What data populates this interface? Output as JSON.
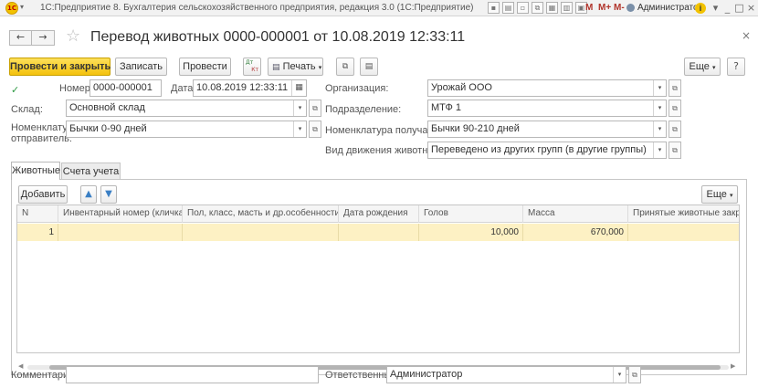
{
  "app": {
    "title": "1С:Предприятие 8. Бухгалтерия сельскохозяйственного предприятия, редакция 3.0  (1С:Предприятие)",
    "logo_text": "1С",
    "user": "Администратор",
    "m_labels": [
      "M",
      "M+",
      "M-"
    ]
  },
  "document": {
    "title": "Перевод животных 0000-000001 от 10.08.2019 12:33:11"
  },
  "toolbar": {
    "post_close": "Провести и закрыть",
    "save": "Записать",
    "post": "Провести",
    "dtkt_top": "Дт",
    "dtkt_bottom": "Кт",
    "print": "Печать",
    "more": "Еще"
  },
  "form": {
    "number_label": "Номер:",
    "number_value": "0000-000001",
    "date_label": "Дата:",
    "date_value": "10.08.2019 12:33:11",
    "warehouse_label": "Склад:",
    "warehouse_value": "Основной склад",
    "sender_label": "Номенклатура отправитель:",
    "sender_value": "Бычки 0-90 дней",
    "org_label": "Организация:",
    "org_value": "Урожай ООО",
    "division_label": "Подразделение:",
    "division_value": "МТФ 1",
    "receiver_label": "Номенклатура получатель:",
    "receiver_value": "Бычки 90-210 дней",
    "movement_label": "Вид движения животных:",
    "movement_value": "Переведено из других групп (в другие группы)"
  },
  "tabs": [
    {
      "label": "Животные"
    },
    {
      "label": "Счета учета"
    }
  ],
  "table_toolbar": {
    "add": "Добавить",
    "more": "Еще"
  },
  "table": {
    "columns": [
      "N",
      "Инвентарный номер (кличка)",
      "Пол, класс, масть и др.особенности",
      "Дата рождения",
      "Голов",
      "Масса",
      "Принятые животные закрепл"
    ],
    "rows": [
      {
        "n": "1",
        "inventory": "",
        "sex": "",
        "birth": "",
        "heads": "10,000",
        "mass": "670,000",
        "fixed": ""
      }
    ]
  },
  "footer": {
    "comment_label": "Комментарий:",
    "comment_value": "",
    "responsible_label": "Ответственный:",
    "responsible_value": "Администратор"
  }
}
